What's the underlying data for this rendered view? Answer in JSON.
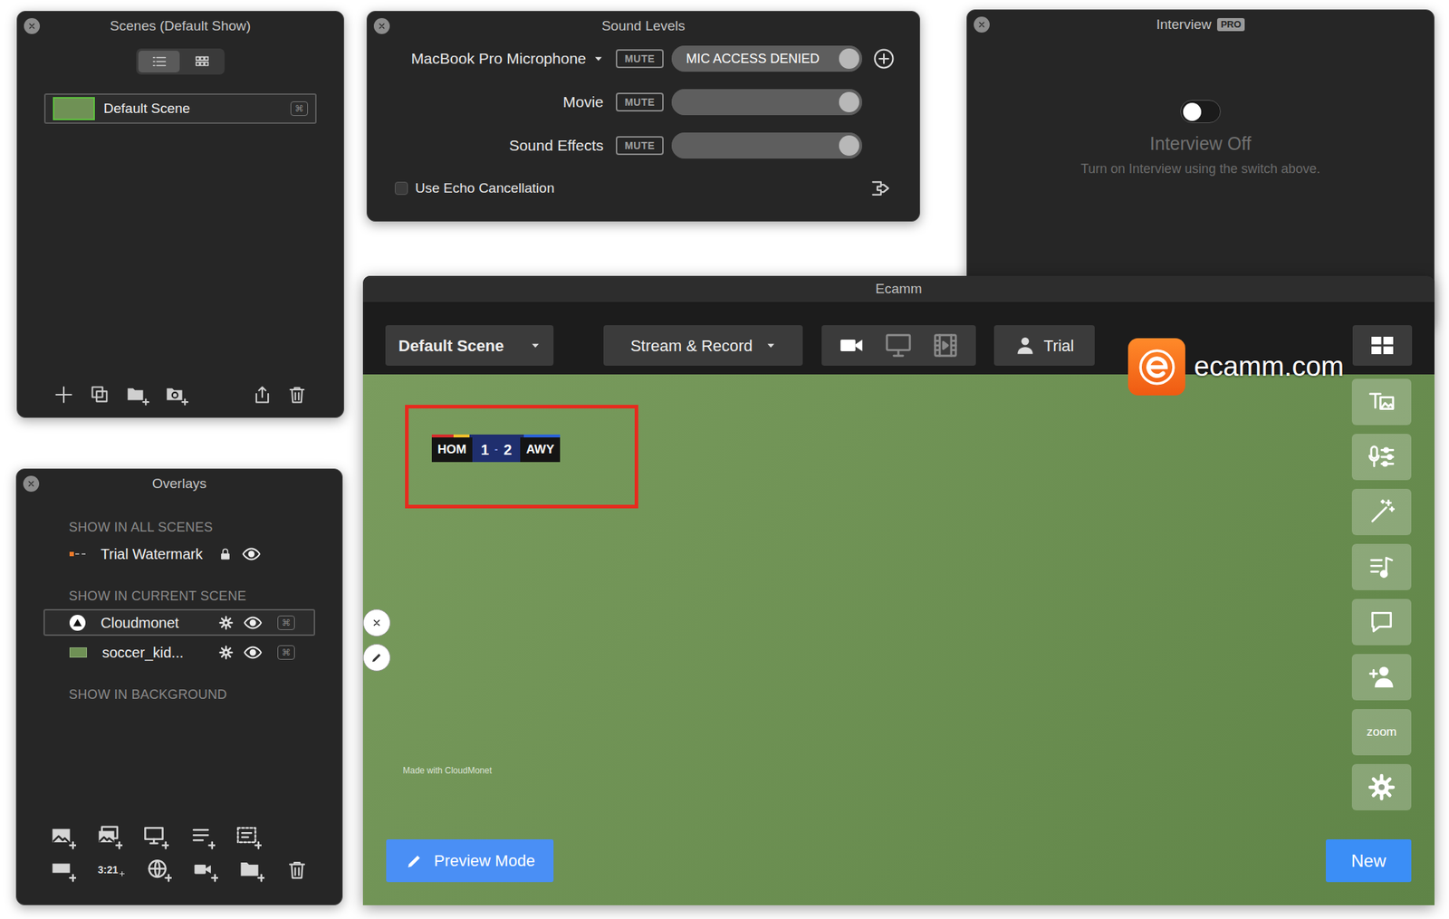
{
  "scenes_window": {
    "title": "Scenes (Default Show)",
    "view_modes": [
      {
        "kind": "list",
        "selected": true
      },
      {
        "kind": "grid",
        "selected": false
      }
    ],
    "scenes": [
      {
        "name": "Default Scene",
        "selected": true,
        "hotkey": "⌘"
      }
    ]
  },
  "sound_window": {
    "title": "Sound Levels",
    "sources": [
      {
        "name": "MacBook Pro Microphone",
        "kind": "device",
        "mute_label": "MUTE",
        "muted": false,
        "level": 1,
        "status": "MIC ACCESS DENIED"
      },
      {
        "name": "Movie",
        "kind": "channel",
        "mute_label": "MUTE",
        "muted": false,
        "level": 1
      },
      {
        "name": "Sound Effects",
        "kind": "channel",
        "mute_label": "MUTE",
        "muted": false,
        "level": 1
      }
    ],
    "echo_cancellation": {
      "label": "Use Echo Cancellation",
      "checked": false
    }
  },
  "interview_window": {
    "title": "Interview",
    "badge": "PRO",
    "enabled": false,
    "status": "Interview Off",
    "hint": "Turn on Interview using the switch above."
  },
  "main_window": {
    "title": "Ecamm",
    "scene_menu": "Default Scene",
    "output_menu": "Stream & Record",
    "sources": [
      {
        "kind": "camera",
        "selected": true
      },
      {
        "kind": "screen",
        "selected": false
      },
      {
        "kind": "movie",
        "selected": false
      }
    ],
    "account": "Trial",
    "brand": "ecamm.com",
    "scoreboard": {
      "highlighted": true,
      "home": "HOM",
      "home_score": "1",
      "separator": "-",
      "away_score": "2",
      "away": "AWY"
    },
    "overlay_credit": "Made with CloudMonet",
    "tools": [
      {
        "kind": "titles"
      },
      {
        "kind": "audio"
      },
      {
        "kind": "effects"
      },
      {
        "kind": "music"
      },
      {
        "kind": "comments"
      },
      {
        "kind": "guests"
      },
      {
        "kind": "zoom",
        "label": "zoom"
      },
      {
        "kind": "settings"
      }
    ],
    "preview_button": "Preview Mode",
    "new_button": "New"
  },
  "overlays_window": {
    "title": "Overlays",
    "sections": [
      {
        "heading": "SHOW IN ALL SCENES",
        "items": [
          {
            "name": "Trial Watermark",
            "kind": "watermark",
            "selected": false,
            "locked": true,
            "visible": true
          }
        ]
      },
      {
        "heading": "SHOW IN CURRENT SCENE",
        "items": [
          {
            "name": "Cloudmonet",
            "kind": "logo",
            "selected": true,
            "locked": false,
            "visible": true,
            "hotkey": "⌘"
          },
          {
            "name": "soccer_kid...",
            "kind": "image",
            "selected": false,
            "locked": false,
            "visible": true,
            "hotkey": "⌘"
          }
        ]
      },
      {
        "heading": "SHOW IN BACKGROUND",
        "items": []
      }
    ],
    "toolbar": {
      "clock_label": "3:21"
    }
  }
}
